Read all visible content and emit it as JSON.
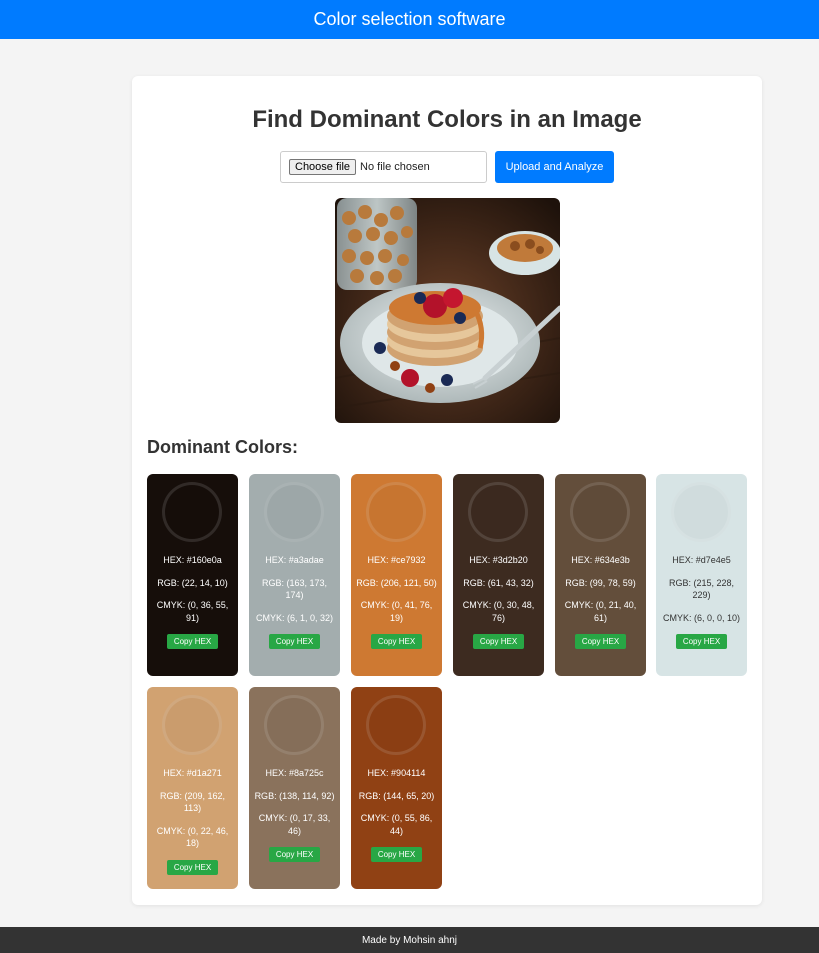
{
  "header": {
    "title": "Color selection software"
  },
  "main": {
    "title": "Find Dominant Colors in an Image",
    "file_input": {
      "button_label": "Choose file",
      "status": "No file chosen"
    },
    "upload_button": "Upload and Analyze",
    "colors_heading": "Dominant Colors:",
    "swatches": [
      {
        "bg": "#160e0a",
        "text": "#ffffff",
        "hex": "HEX: #160e0a",
        "rgb": "RGB: (22, 14, 10)",
        "cmyk": "CMYK: (0, 36, 55, 91)",
        "copy": "Copy HEX"
      },
      {
        "bg": "#a3adae",
        "text": "#ffffff",
        "hex": "HEX: #a3adae",
        "rgb": "RGB: (163, 173, 174)",
        "cmyk": "CMYK: (6, 1, 0, 32)",
        "copy": "Copy HEX"
      },
      {
        "bg": "#ce7932",
        "text": "#ffffff",
        "hex": "HEX: #ce7932",
        "rgb": "RGB: (206, 121, 50)",
        "cmyk": "CMYK: (0, 41, 76, 19)",
        "copy": "Copy HEX"
      },
      {
        "bg": "#3d2b20",
        "text": "#ffffff",
        "hex": "HEX: #3d2b20",
        "rgb": "RGB: (61, 43, 32)",
        "cmyk": "CMYK: (0, 30, 48, 76)",
        "copy": "Copy HEX"
      },
      {
        "bg": "#634e3b",
        "text": "#ffffff",
        "hex": "HEX: #634e3b",
        "rgb": "RGB: (99, 78, 59)",
        "cmyk": "CMYK: (0, 21, 40, 61)",
        "copy": "Copy HEX"
      },
      {
        "bg": "#d7e4e5",
        "text": "#333333",
        "hex": "HEX: #d7e4e5",
        "rgb": "RGB: (215, 228, 229)",
        "cmyk": "CMYK: (6, 0, 0, 10)",
        "copy": "Copy HEX"
      },
      {
        "bg": "#d1a271",
        "text": "#ffffff",
        "hex": "HEX: #d1a271",
        "rgb": "RGB: (209, 162, 113)",
        "cmyk": "CMYK: (0, 22, 46, 18)",
        "copy": "Copy HEX"
      },
      {
        "bg": "#8a725c",
        "text": "#ffffff",
        "hex": "HEX: #8a725c",
        "rgb": "RGB: (138, 114, 92)",
        "cmyk": "CMYK: (0, 17, 33, 46)",
        "copy": "Copy HEX"
      },
      {
        "bg": "#904114",
        "text": "#ffffff",
        "hex": "HEX: #904114",
        "rgb": "RGB: (144, 65, 20)",
        "cmyk": "CMYK: (0, 55, 86, 44)",
        "copy": "Copy HEX"
      }
    ]
  },
  "footer": {
    "text": "Made by Mohsin ahnj"
  },
  "colors": {
    "primary": "#007bff",
    "success": "#28a745",
    "footer_bg": "#333333"
  }
}
